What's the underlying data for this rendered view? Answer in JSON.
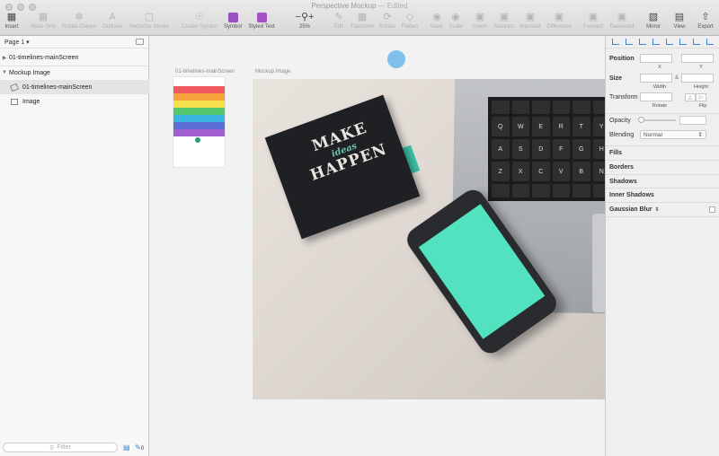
{
  "window": {
    "title": "Perspective Mockup",
    "edited": "— Edited"
  },
  "toolbar": {
    "insert": "Insert",
    "make_grid": "Make Grid",
    "rotate_copies": "Rotate Copies",
    "outlines": "Outlines",
    "vectorize_stroke": "Vectorize Stroke",
    "create_symbol": "Create Symbol",
    "symbol": "Symbol",
    "styled_text": "Styled Text",
    "zoom_value": "25%",
    "edit": "Edit",
    "transform": "Transform",
    "rotate": "Rotate",
    "flatten": "Flatten",
    "mask": "Mask",
    "scale": "Scale",
    "union": "Union",
    "subtract": "Subtract",
    "intersect": "Intersect",
    "difference": "Difference",
    "forward": "Forward",
    "backward": "Backward",
    "mirror": "Mirror",
    "view": "View",
    "export": "Export",
    "symbol_color": "#9b4fc4",
    "styled_text_color": "#a54fc8"
  },
  "sidebar": {
    "page_label": "Page 1",
    "layers": [
      {
        "label": "01-timelines-mainScreen"
      },
      {
        "label": "Mockup Image"
      },
      {
        "label": "01-timelines-mainScreen"
      },
      {
        "label": "Image"
      }
    ],
    "filter_placeholder": "Filter",
    "export_count": "0"
  },
  "canvas": {
    "artboard_label_1": "01-timelines-mainScreen",
    "artboard_label_2": "Mockup Image",
    "book_line_1": "MAKE",
    "book_line_2": "ideas",
    "book_line_3": "HAPPEN",
    "keys": [
      "",
      "",
      "",
      "",
      "",
      "",
      "Q",
      "W",
      "E",
      "R",
      "T",
      "Y",
      "A",
      "S",
      "D",
      "F",
      "G",
      "H",
      "Z",
      "X",
      "C",
      "V",
      "B",
      "N",
      "",
      "",
      "",
      "",
      "",
      ""
    ],
    "stripe_colors": [
      "#f25a62",
      "#f6a23b",
      "#f4e04a",
      "#54c66b",
      "#3bb6e0",
      "#5b6fd6",
      "#a15fd1"
    ],
    "phone_screen_color": "#52e2c0"
  },
  "inspector": {
    "position_label": "Position",
    "x_label": "X",
    "y_label": "Y",
    "size_label": "Size",
    "width_label": "Width",
    "height_label": "Height",
    "transform_label": "Transform",
    "rotate_label": "Rotate",
    "flip_label": "Flip",
    "opacity_label": "Opacity",
    "blending_label": "Blending",
    "blending_value": "Normal",
    "fills_label": "Fills",
    "borders_label": "Borders",
    "shadows_label": "Shadows",
    "inner_shadows_label": "Inner Shadows",
    "gaussian_blur_label": "Gaussian Blur"
  }
}
